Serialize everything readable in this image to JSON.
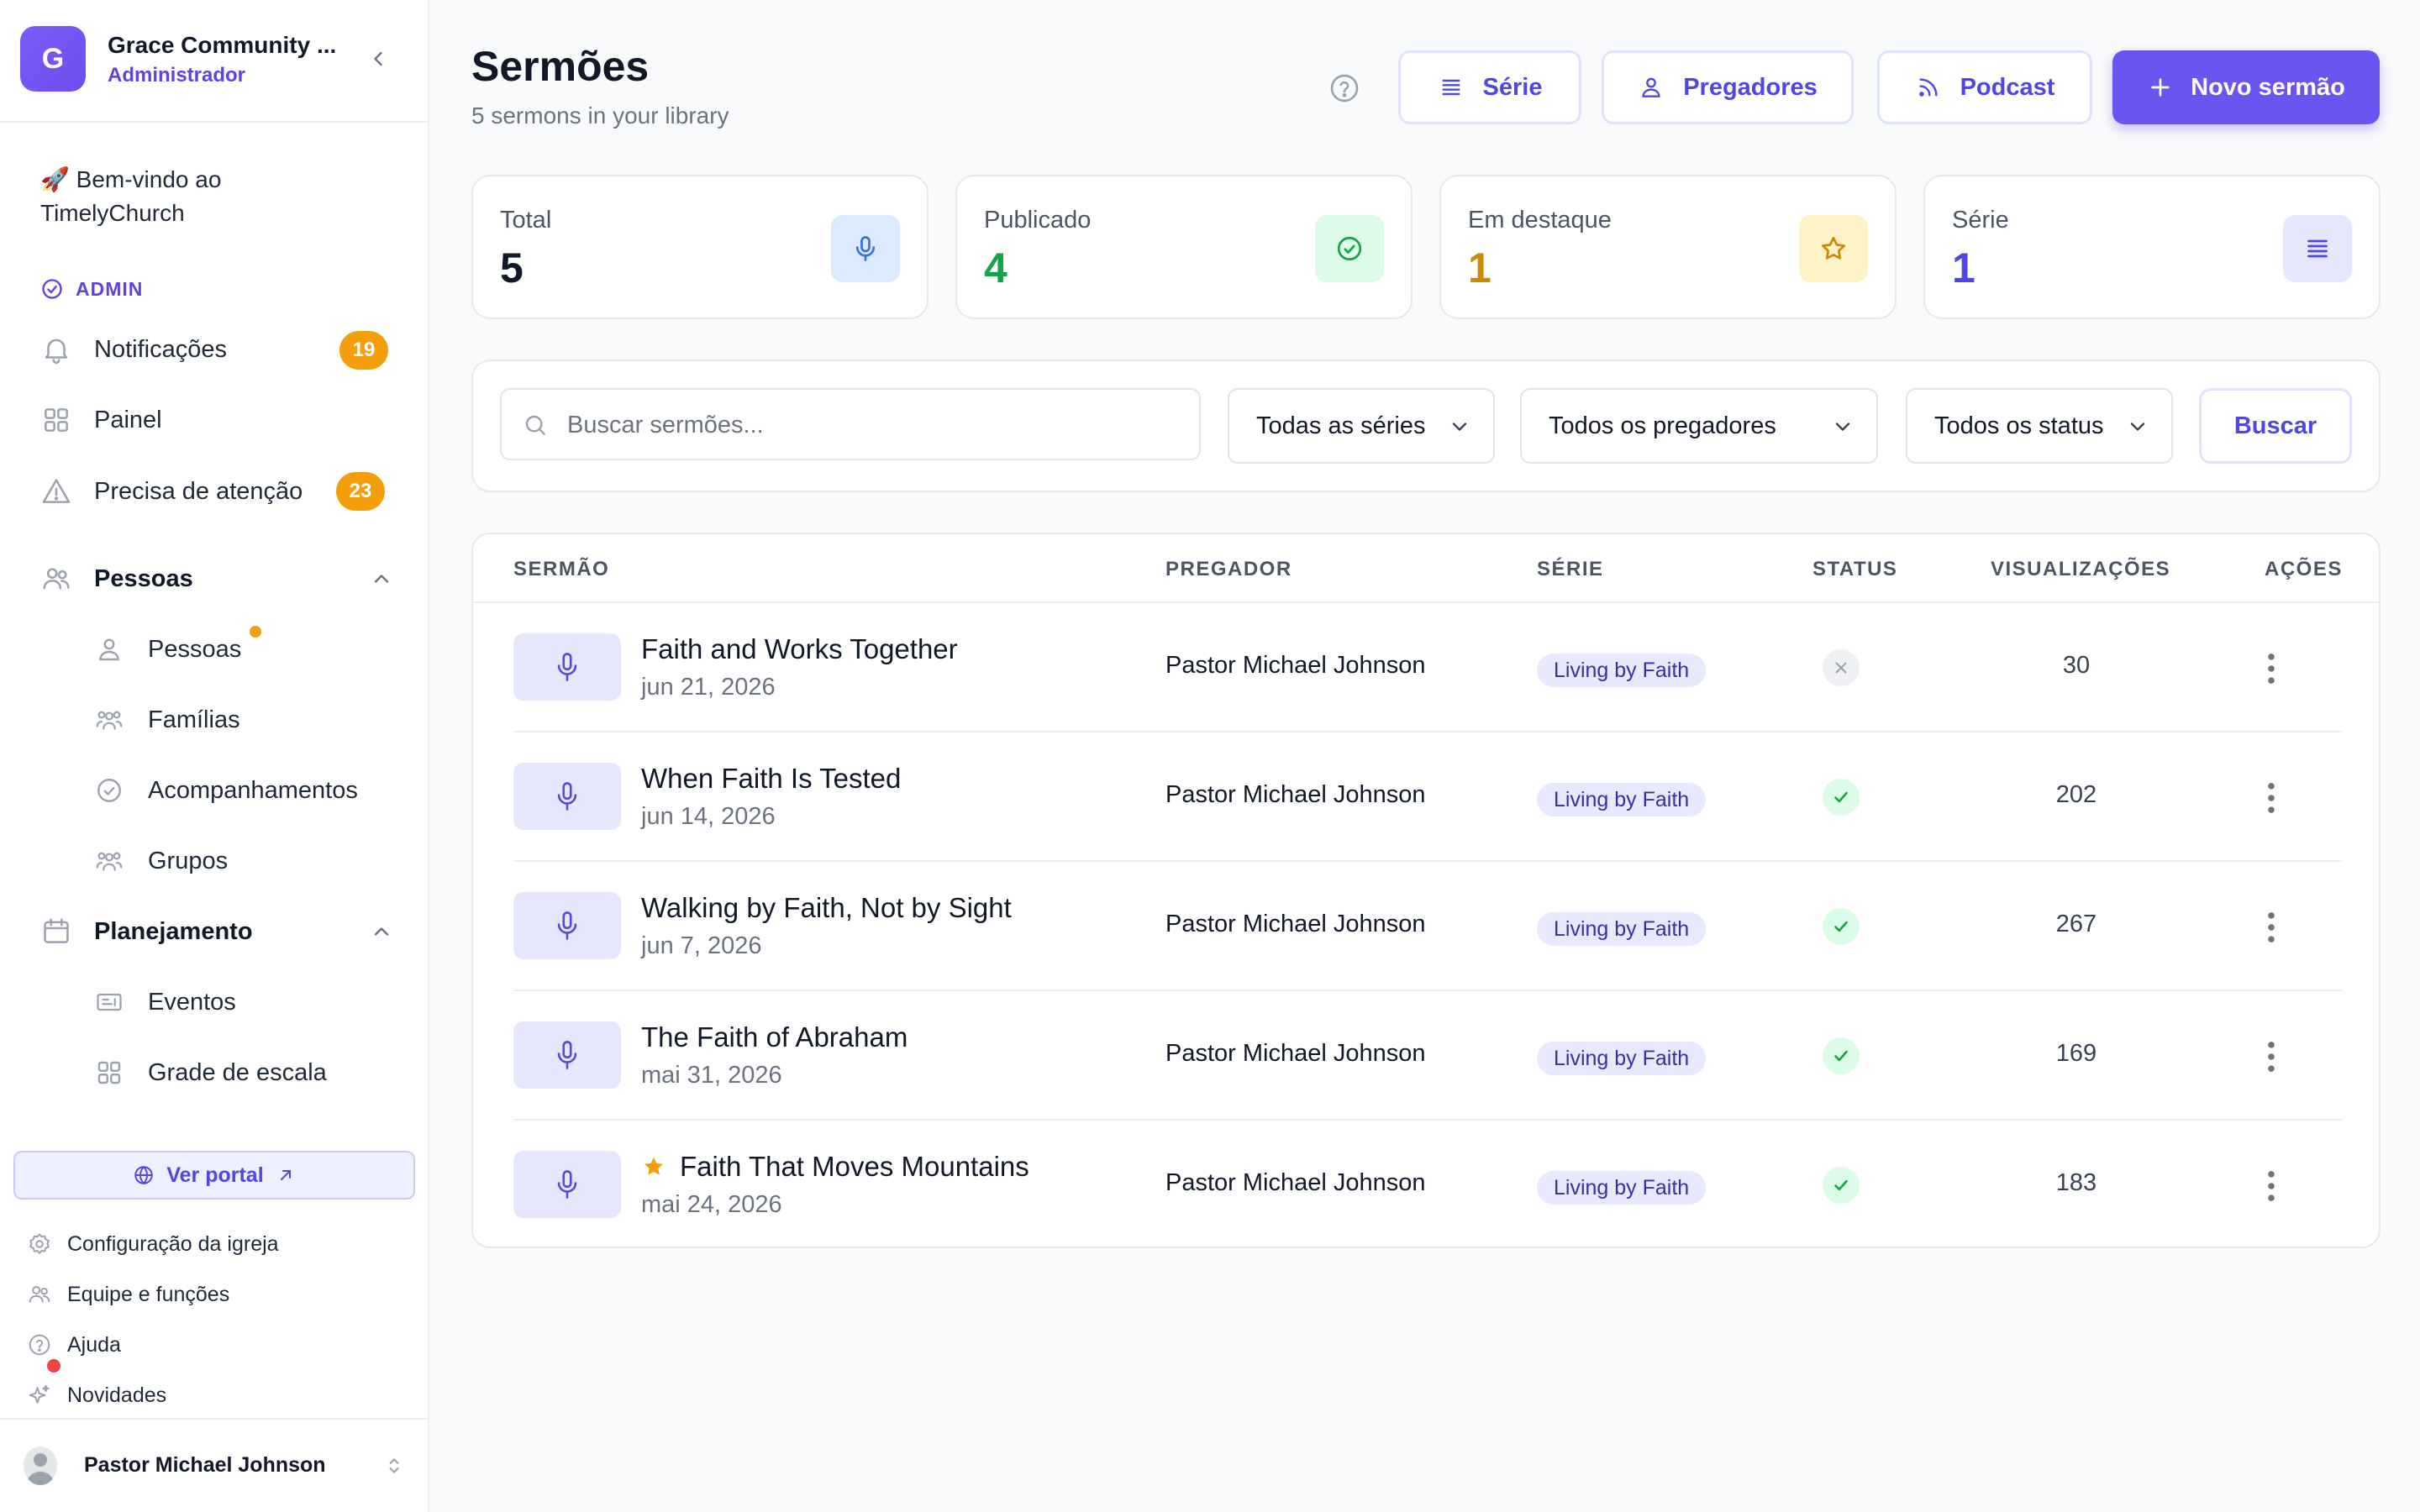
{
  "org": {
    "initial": "G",
    "name": "Grace Community ...",
    "role": "Administrador"
  },
  "sidebar": {
    "welcome": "🚀 Bem-vindo ao TimelyChurch",
    "admin_label": "ADMIN",
    "nav": [
      {
        "label": "Notificações",
        "icon": "bell-icon",
        "badge": "19"
      },
      {
        "label": "Painel",
        "icon": "grid-icon"
      },
      {
        "label": "Precisa de atenção",
        "icon": "warning-icon",
        "badge": "23"
      }
    ],
    "sections": [
      {
        "label": "Pessoas",
        "icon": "people-icon",
        "items": [
          {
            "label": "Pessoas",
            "icon": "person-icon"
          },
          {
            "label": "Famílias",
            "icon": "family-icon"
          },
          {
            "label": "Acompanhamentos",
            "icon": "check-circle-icon"
          },
          {
            "label": "Grupos",
            "icon": "groups-icon"
          }
        ]
      },
      {
        "label": "Planejamento",
        "icon": "calendar-icon",
        "items": [
          {
            "label": "Eventos",
            "icon": "ticket-icon"
          },
          {
            "label": "Grade de escala",
            "icon": "grid-icon"
          }
        ]
      }
    ],
    "portal_button": "Ver portal",
    "footer_links": [
      {
        "label": "Configuração da igreja",
        "icon": "gear-icon"
      },
      {
        "label": "Equipe e funções",
        "icon": "team-icon"
      },
      {
        "label": "Ajuda",
        "icon": "help-icon"
      },
      {
        "label": "Novidades",
        "icon": "sparkle-icon"
      }
    ],
    "user_name": "Pastor Michael Johnson"
  },
  "header": {
    "title": "Sermões",
    "subtitle": "5 sermons in your library",
    "buttons": {
      "series": "Série",
      "preachers": "Pregadores",
      "podcast": "Podcast",
      "new_sermon": "Novo sermão"
    }
  },
  "stats": [
    {
      "label": "Total",
      "value": "5",
      "color": "#111827",
      "icon": "microphone-icon",
      "icon_bg": "#dbeafe",
      "icon_color": "#3b6fe0"
    },
    {
      "label": "Publicado",
      "value": "4",
      "color": "#16a34a",
      "icon": "check-circle-icon",
      "icon_bg": "#dcfce7",
      "icon_color": "#16a34a"
    },
    {
      "label": "Em destaque",
      "value": "1",
      "color": "#ca8a04",
      "icon": "star-icon",
      "icon_bg": "#fef3c7",
      "icon_color": "#ca8a04"
    },
    {
      "label": "Série",
      "value": "1",
      "color": "#4f46e5",
      "icon": "list-icon",
      "icon_bg": "#e6e7fd",
      "icon_color": "#4f46e5"
    }
  ],
  "filters": {
    "search_placeholder": "Buscar sermões...",
    "series_select": "Todas as séries",
    "preacher_select": "Todos os pregadores",
    "status_select": "Todos os status",
    "search_button": "Buscar"
  },
  "table": {
    "columns": [
      "SERMÃO",
      "PREGADOR",
      "SÉRIE",
      "STATUS",
      "VISUALIZAÇÕES",
      "AÇÕES"
    ],
    "rows": [
      {
        "title": "Faith and Works Together",
        "date": "jun 21, 2026",
        "preacher": "Pastor Michael Johnson",
        "series": "Living by Faith",
        "status": "draft",
        "views": "30",
        "featured": false
      },
      {
        "title": "When Faith Is Tested",
        "date": "jun 14, 2026",
        "preacher": "Pastor Michael Johnson",
        "series": "Living by Faith",
        "status": "published",
        "views": "202",
        "featured": false
      },
      {
        "title": "Walking by Faith, Not by Sight",
        "date": "jun 7, 2026",
        "preacher": "Pastor Michael Johnson",
        "series": "Living by Faith",
        "status": "published",
        "views": "267",
        "featured": false
      },
      {
        "title": "The Faith of Abraham",
        "date": "mai 31, 2026",
        "preacher": "Pastor Michael Johnson",
        "series": "Living by Faith",
        "status": "published",
        "views": "169",
        "featured": false
      },
      {
        "title": "Faith That Moves Mountains",
        "date": "mai 24, 2026",
        "preacher": "Pastor Michael Johnson",
        "series": "Living by Faith",
        "status": "published",
        "views": "183",
        "featured": true
      }
    ]
  },
  "colors": {
    "accent": "#6b55f0",
    "accent_text": "#4f46e5",
    "warning_badge": "#f59e0b",
    "published": "#16a34a",
    "featured_star": "#f59e0b"
  }
}
